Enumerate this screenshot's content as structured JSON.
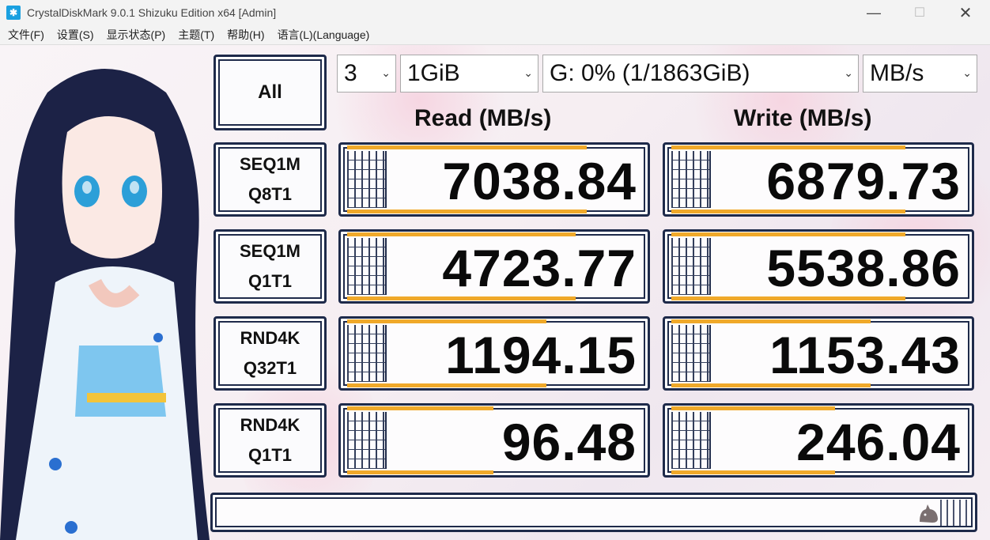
{
  "window": {
    "title": "CrystalDiskMark 9.0.1 Shizuku Edition x64 [Admin]",
    "minimize_glyph": "—",
    "maximize_glyph": "☐",
    "close_glyph": "✕"
  },
  "menu": [
    {
      "label": "文件(F)"
    },
    {
      "label": "设置(S)"
    },
    {
      "label": "显示状态(P)"
    },
    {
      "label": "主题(T)"
    },
    {
      "label": "帮助(H)"
    },
    {
      "label": "语言(L)(Language)"
    }
  ],
  "controls": {
    "all_label": "All",
    "count": "3",
    "size": "1GiB",
    "drive": "G: 0% (1/1863GiB)",
    "unit": "MB/s"
  },
  "headers": {
    "read": "Read (MB/s)",
    "write": "Write (MB/s)"
  },
  "tests": [
    {
      "line1": "SEQ1M",
      "line2": "Q8T1",
      "read": "7038.84",
      "write": "6879.73",
      "read_fill": 0.82,
      "write_fill": 0.8
    },
    {
      "line1": "SEQ1M",
      "line2": "Q1T1",
      "read": "4723.77",
      "write": "5538.86",
      "read_fill": 0.78,
      "write_fill": 0.8
    },
    {
      "line1": "RND4K",
      "line2": "Q32T1",
      "read": "1194.15",
      "write": "1153.43",
      "read_fill": 0.68,
      "write_fill": 0.68
    },
    {
      "line1": "RND4K",
      "line2": "Q1T1",
      "read": "96.48",
      "write": "246.04",
      "read_fill": 0.5,
      "write_fill": 0.56
    }
  ],
  "comment": "",
  "colors": {
    "frame": "#1e2a4a",
    "bar": "#f0a92a"
  },
  "icons": {
    "app": "crystaldiskmark-icon",
    "mascot": "cat-icon"
  }
}
